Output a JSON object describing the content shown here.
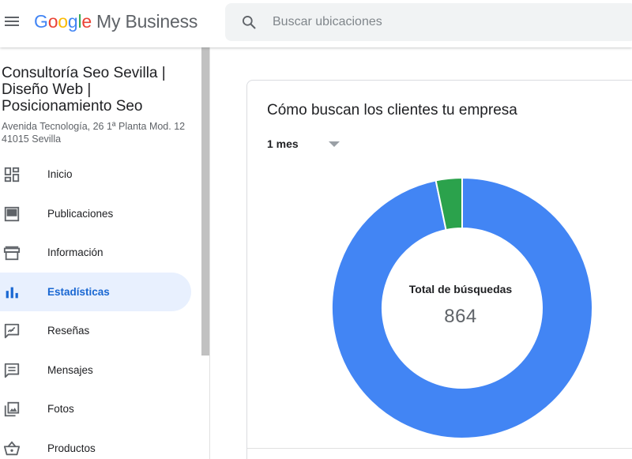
{
  "header": {
    "logo_google_letters": [
      "G",
      "o",
      "o",
      "g",
      "l",
      "e"
    ],
    "logo_product": "My Business",
    "search_placeholder": "Buscar ubicaciones"
  },
  "business": {
    "name": "Consultoría Seo Sevilla | Diseño Web | Posicionamiento Seo",
    "address_line1": "Avenida Tecnología, 26 1ª Planta Mod. 12",
    "address_line2": "41015 Sevilla"
  },
  "sidebar": {
    "items": [
      {
        "label": "Inicio",
        "icon": "dashboard-icon",
        "active": false
      },
      {
        "label": "Publicaciones",
        "icon": "posts-icon",
        "active": false
      },
      {
        "label": "Información",
        "icon": "store-icon",
        "active": false
      },
      {
        "label": "Estadísticas",
        "icon": "bar-chart-icon",
        "active": true
      },
      {
        "label": "Reseñas",
        "icon": "reviews-icon",
        "active": false
      },
      {
        "label": "Mensajes",
        "icon": "messages-icon",
        "active": false
      },
      {
        "label": "Fotos",
        "icon": "photos-icon",
        "active": false
      },
      {
        "label": "Productos",
        "icon": "basket-icon",
        "active": false
      }
    ]
  },
  "card": {
    "title": "Cómo buscan los clientes tu empresa",
    "period_selected": "1 mes",
    "center_label": "Total de búsquedas",
    "center_value": "864"
  },
  "chart_data": {
    "type": "pie",
    "variant": "donut",
    "total": 864,
    "slices": [
      {
        "value": 836,
        "color": "#4285F4"
      },
      {
        "value": 28,
        "color": "#2BA24C"
      }
    ]
  },
  "colors": {
    "accent": "#1967d2",
    "active_bg": "#e8f0fe",
    "blue_slice": "#4285F4",
    "green_slice": "#2BA24C"
  }
}
